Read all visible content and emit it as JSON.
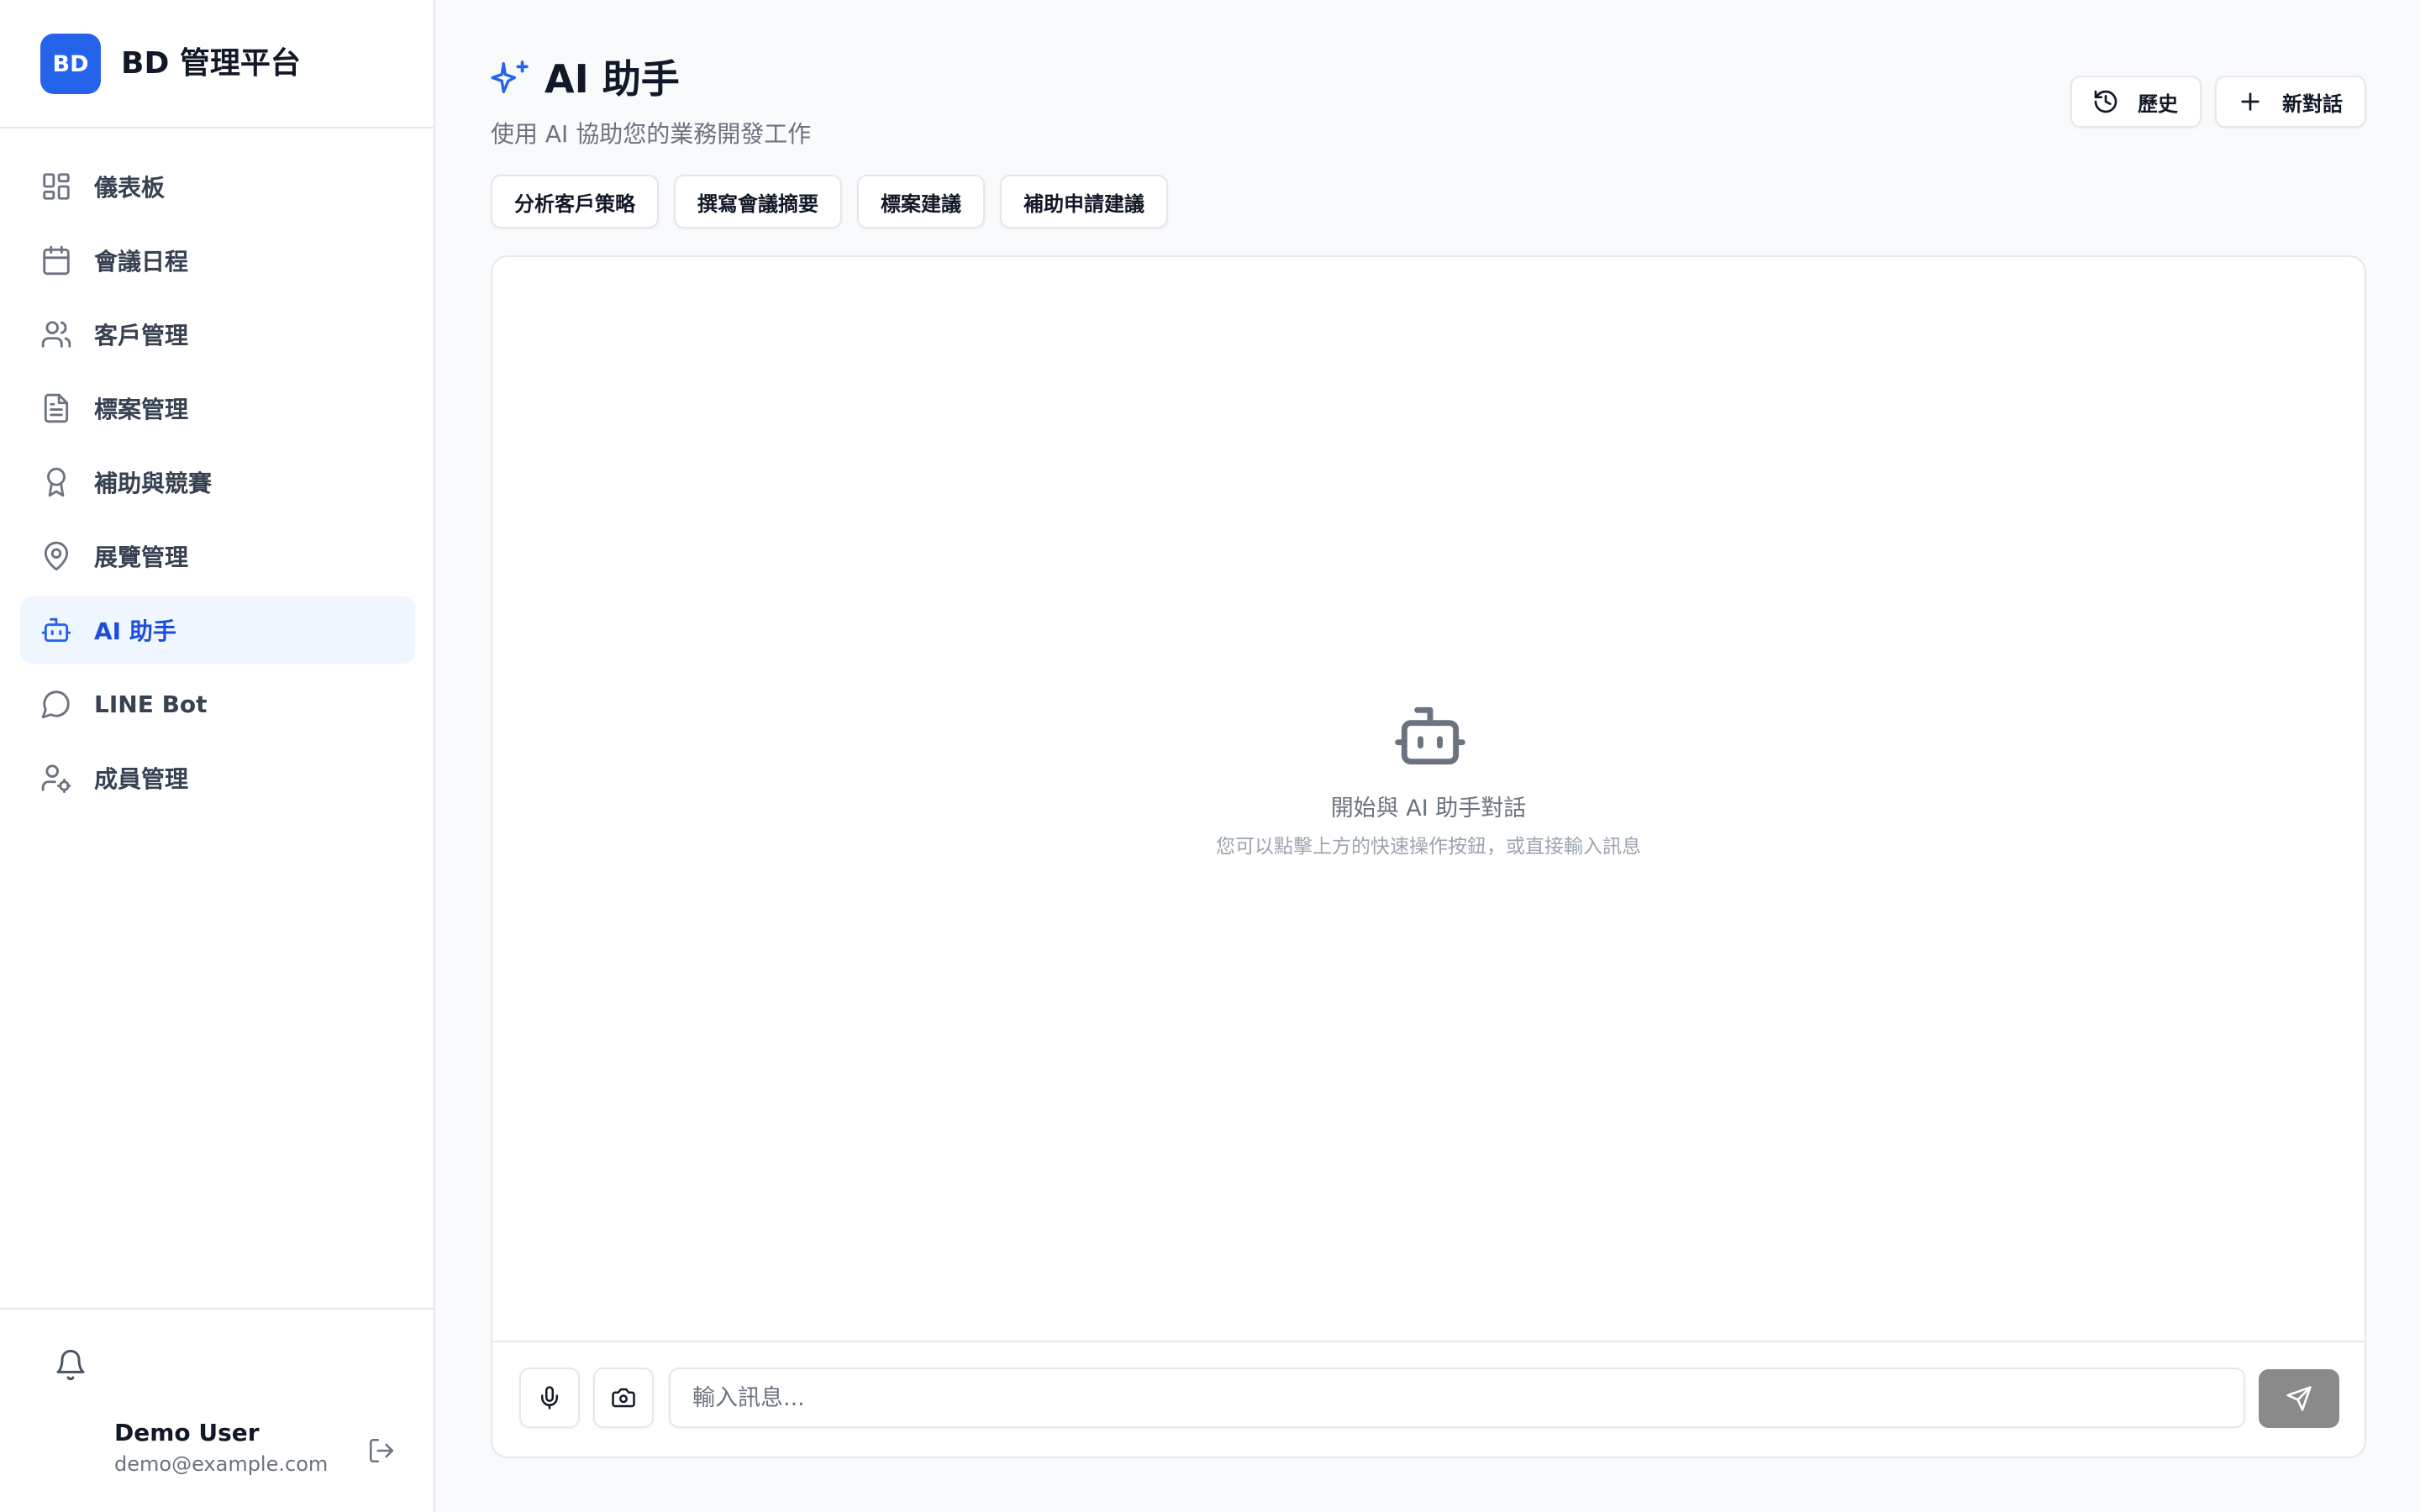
{
  "brand": {
    "logo": "BD",
    "name": "BD 管理平台"
  },
  "sidebar": {
    "items": [
      {
        "label": "儀表板",
        "icon": "dashboard-icon",
        "active": false
      },
      {
        "label": "會議日程",
        "icon": "calendar-icon",
        "active": false
      },
      {
        "label": "客戶管理",
        "icon": "users-icon",
        "active": false
      },
      {
        "label": "標案管理",
        "icon": "file-text-icon",
        "active": false
      },
      {
        "label": "補助與競賽",
        "icon": "award-icon",
        "active": false
      },
      {
        "label": "展覽管理",
        "icon": "map-pin-icon",
        "active": false
      },
      {
        "label": "AI 助手",
        "icon": "bot-icon",
        "active": true
      },
      {
        "label": "LINE Bot",
        "icon": "message-circle-icon",
        "active": false
      },
      {
        "label": "成員管理",
        "icon": "user-cog-icon",
        "active": false
      }
    ],
    "footer": {
      "user_name": "Demo User",
      "user_email": "demo@example.com"
    }
  },
  "header": {
    "title": "AI 助手",
    "subtitle": "使用 AI 協助您的業務開發工作",
    "history_label": "歷史",
    "new_chat_label": "新對話"
  },
  "quick_actions": [
    {
      "label": "分析客戶策略"
    },
    {
      "label": "撰寫會議摘要"
    },
    {
      "label": "標案建議"
    },
    {
      "label": "補助申請建議"
    }
  ],
  "chat": {
    "empty_title": "開始與 AI 助手對話",
    "empty_hint": "您可以點擊上方的快速操作按鈕，或直接輸入訊息",
    "input_placeholder": "輸入訊息...",
    "input_value": ""
  },
  "colors": {
    "accent": "#2563eb",
    "active_bg": "#eff6ff",
    "send_button": "#8a8a8a",
    "border": "#e5e7eb"
  }
}
